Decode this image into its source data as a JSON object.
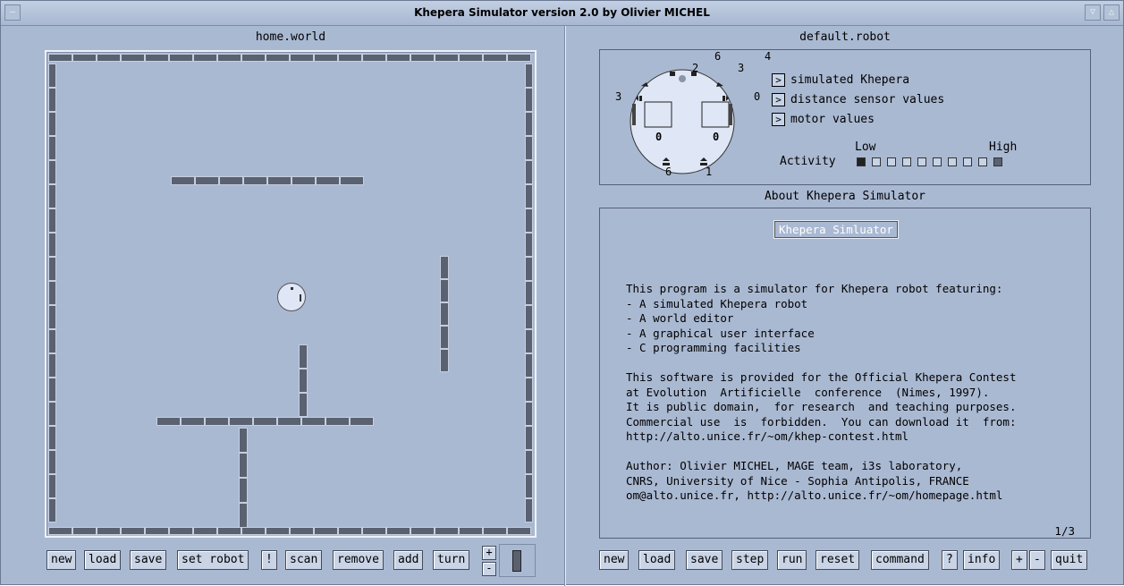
{
  "window": {
    "title": "Khepera Simulator version 2.0 by Olivier MICHEL"
  },
  "world": {
    "title": "home.world",
    "buttons": [
      "new",
      "load",
      "save",
      "set robot",
      "!",
      "scan",
      "remove",
      "add",
      "turn"
    ],
    "zoom_plus": "+",
    "zoom_minus": "-"
  },
  "robot": {
    "title": "default.robot",
    "sensor_labels": [
      "6",
      "4",
      "2",
      "3",
      "3",
      "0",
      "6",
      "1"
    ],
    "motor_labels": [
      "0",
      "0"
    ],
    "options": [
      {
        "label": "simulated Khepera",
        "state": ">"
      },
      {
        "label": "distance sensor values",
        "state": ">"
      },
      {
        "label": "motor values",
        "state": ">"
      }
    ],
    "activity_label": "Activity",
    "activity_low": "Low",
    "activity_high": "High"
  },
  "about": {
    "title": "About Khepera Simulator",
    "heading": "Khepera Simluator",
    "lines": [
      "This program is a simulator for Khepera robot featuring:",
      "- A simulated Khepera robot",
      "- A world editor",
      "- A graphical user interface",
      "- C programming facilities",
      "",
      "This software is provided for the Official Khepera Contest",
      "at Evolution  Artificielle  conference  (Nimes, 1997).",
      "It is public domain,  for research  and teaching purposes.",
      "Commercial use  is  forbidden.  You can download it  from:",
      "http://alto.unice.fr/~om/khep-contest.html",
      "",
      "Author: Olivier MICHEL, MAGE team, i3s laboratory,",
      "CNRS, University of Nice - Sophia Antipolis, FRANCE",
      "om@alto.unice.fr, http://alto.unice.fr/~om/homepage.html"
    ],
    "page": "1/3"
  },
  "controls": {
    "buttons": [
      "new",
      "load",
      "save",
      "step",
      "run",
      "reset",
      "command",
      "?",
      "info",
      "+",
      "-",
      "quit"
    ]
  }
}
